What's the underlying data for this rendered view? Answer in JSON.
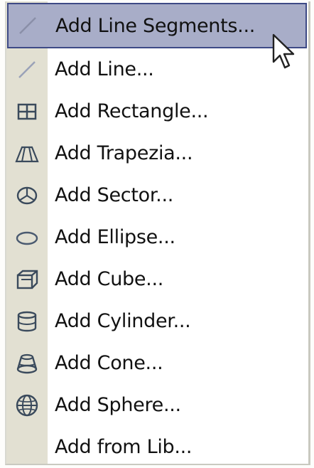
{
  "menu": {
    "items": [
      {
        "label": "Add Line Segments...",
        "icon": "line-segments-icon",
        "selected": true
      },
      {
        "label": "Add Line...",
        "icon": "line-icon",
        "selected": false
      },
      {
        "label": "Add Rectangle...",
        "icon": "rectangle-icon",
        "selected": false
      },
      {
        "label": "Add Trapezia...",
        "icon": "trapezia-icon",
        "selected": false
      },
      {
        "label": "Add Sector...",
        "icon": "sector-icon",
        "selected": false
      },
      {
        "label": "Add Ellipse...",
        "icon": "ellipse-icon",
        "selected": false
      },
      {
        "label": "Add Cube...",
        "icon": "cube-icon",
        "selected": false
      },
      {
        "label": "Add Cylinder...",
        "icon": "cylinder-icon",
        "selected": false
      },
      {
        "label": "Add Cone...",
        "icon": "cone-icon",
        "selected": false
      },
      {
        "label": "Add Sphere...",
        "icon": "sphere-icon",
        "selected": false
      },
      {
        "label": "Add from Lib...",
        "icon": "",
        "selected": false
      }
    ]
  },
  "colors": {
    "highlight": "#a8adc8",
    "highlight_border": "#3e4a86",
    "gutter": "#e2e0d2",
    "icon_stroke": "#3a4a5c"
  },
  "cursor": {
    "icon": "arrow-cursor-icon"
  }
}
